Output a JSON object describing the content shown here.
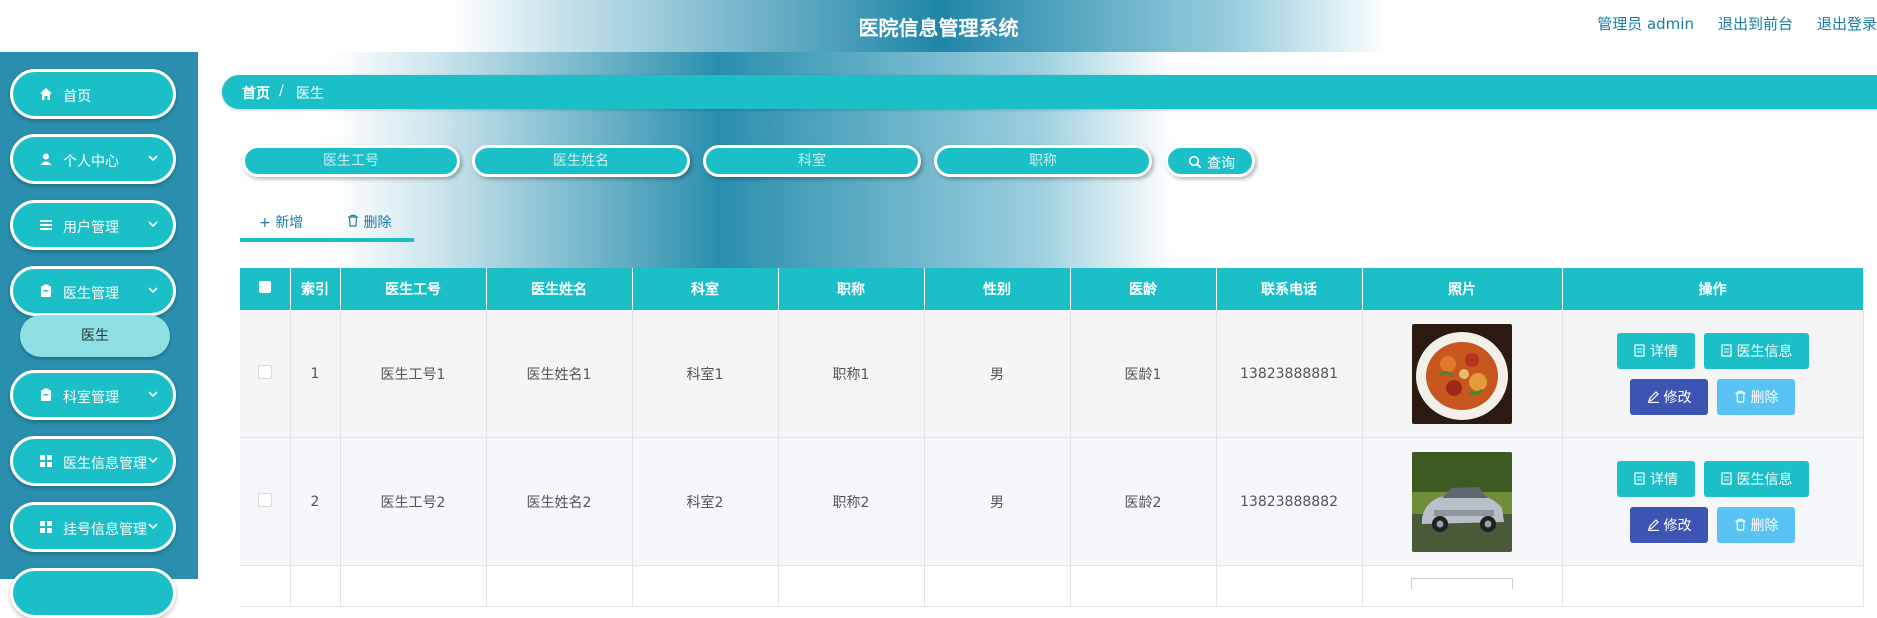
{
  "header": {
    "title": "医院信息管理系统",
    "links": [
      "管理员 admin",
      "退出到前台",
      "退出登录"
    ]
  },
  "sidebar": {
    "items": [
      {
        "label": "首页",
        "icon": "home-icon"
      },
      {
        "label": "个人中心",
        "icon": "user-icon"
      },
      {
        "label": "用户管理",
        "icon": "list-icon"
      },
      {
        "label": "医生管理",
        "icon": "clipboard-icon"
      },
      {
        "label": "科室管理",
        "icon": "clipboard-icon"
      },
      {
        "label": "医生信息管理",
        "icon": "grid-icon"
      },
      {
        "label": "挂号信息管理",
        "icon": "grid-icon"
      }
    ],
    "subitem": "医生"
  },
  "breadcrumb": {
    "home": "首页",
    "separator": "/",
    "current": "医生"
  },
  "search": {
    "placeholders": [
      "医生工号",
      "医生姓名",
      "科室",
      "职称"
    ],
    "button": "查询"
  },
  "actions": {
    "add": "新增",
    "delete": "删除"
  },
  "table": {
    "headers": [
      "索引",
      "医生工号",
      "医生姓名",
      "科室",
      "职称",
      "性别",
      "医龄",
      "联系电话",
      "照片",
      "操作"
    ],
    "rows": [
      {
        "index": "1",
        "code": "医生工号1",
        "name": "医生姓名1",
        "dept": "科室1",
        "title": "职称1",
        "gender": "男",
        "years": "医龄1",
        "phone": "13823888881",
        "photo": "food-dish-photo"
      },
      {
        "index": "2",
        "code": "医生工号2",
        "name": "医生姓名2",
        "dept": "科室2",
        "title": "职称2",
        "gender": "男",
        "years": "医龄2",
        "phone": "13823888882",
        "photo": "silver-car-photo"
      }
    ],
    "row_buttons": {
      "detail": "详情",
      "doctor": "医生信息",
      "edit": "修改",
      "delete": "删除"
    }
  },
  "colors": {
    "accent": "#1bbfc7",
    "sidebar": "#2a8fae",
    "edit_button": "#3c55b4",
    "delete_button": "#59c3f4",
    "link": "#1a7ca6"
  }
}
